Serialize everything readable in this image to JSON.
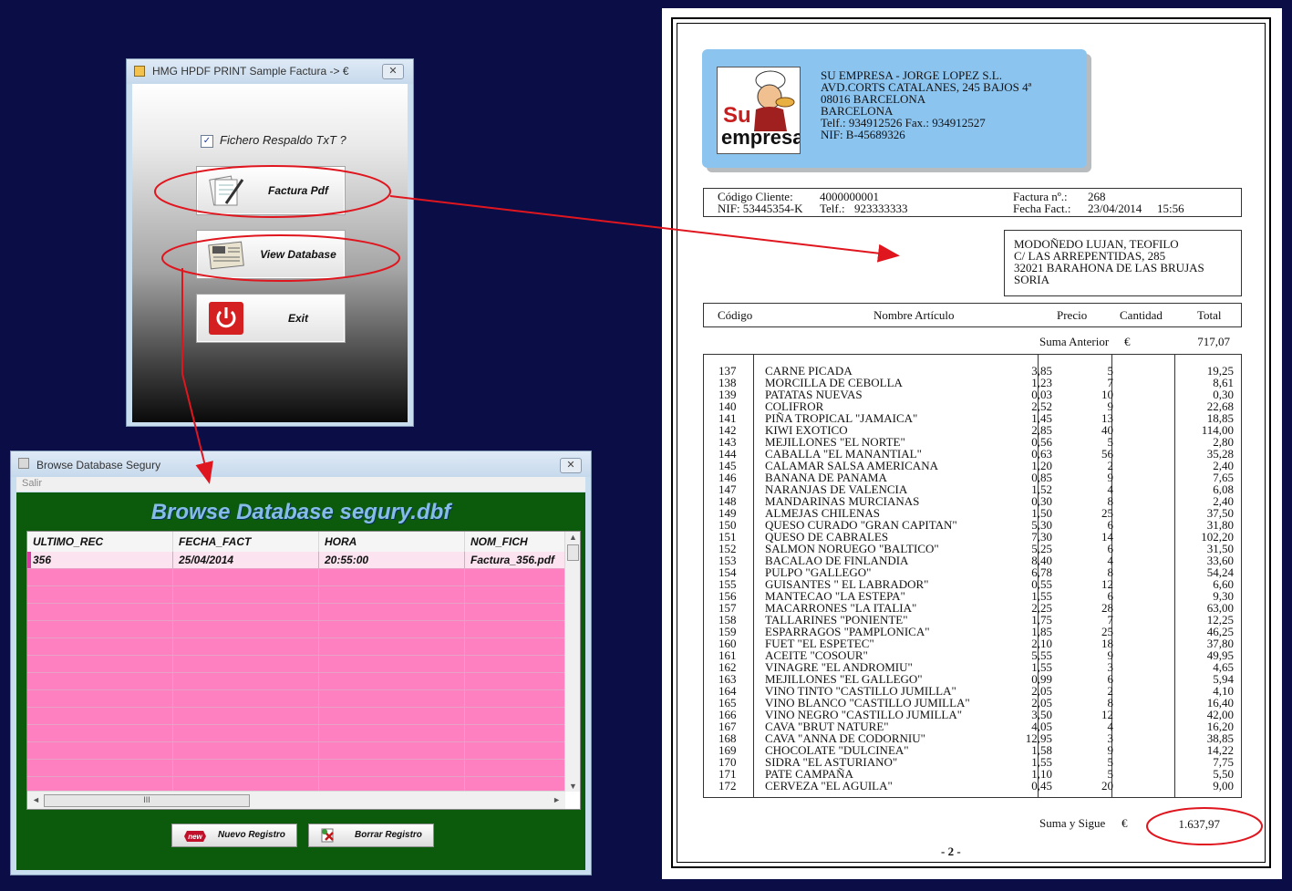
{
  "main_window": {
    "title": "HMG HPDF PRINT Sample Factura -> €",
    "checkbox_label": "Fichero Respaldo TxT ?",
    "checkbox_checked": true,
    "buttons": [
      "Factura Pdf",
      "View Database",
      "Exit"
    ]
  },
  "browse_window": {
    "title": "Browse Database Segury",
    "menu": [
      "Salir"
    ],
    "heading": "Browse Database segury.dbf",
    "columns": [
      "ULTIMO_REC",
      "FECHA_FACT",
      "HORA",
      "NOM_FICH"
    ],
    "rows": [
      [
        "356",
        "25/04/2014",
        "20:55:00",
        "Factura_356.pdf"
      ]
    ],
    "scroll_thumb": "III",
    "buttons": [
      "Nuevo Registro",
      "Borrar Registro"
    ],
    "new_badge": "new"
  },
  "invoice": {
    "logo": {
      "line1": "Su",
      "line2": "empresa"
    },
    "company_lines": [
      "SU EMPRESA - JORGE LOPEZ S.L.",
      "AVD.CORTS CATALANES, 245 BAJOS 4ª",
      "08016 BARCELONA",
      "BARCELONA",
      "Telf.: 934912526  Fax.: 934912527",
      "NIF:   B-45689326"
    ],
    "client_code_label": "Código Cliente:",
    "client_code": "4000000001",
    "nif": "NIF: 53445354-K",
    "phone_label": "Telf.:",
    "phone": "923333333",
    "invoice_no_label": "Factura nº.:",
    "invoice_no": "268",
    "date_label": "Fecha Fact.:",
    "date": "23/04/2014",
    "time": "15:56",
    "address": [
      "MODOÑEDO LUJAN, TEOFILO",
      "C/ LAS ARREPENTIDAS, 285",
      "32021 BARAHONA DE LAS BRUJAS",
      "SORIA"
    ],
    "col_headers": [
      "Código",
      "Nombre Artículo",
      "Precio",
      "Cantidad",
      "Total"
    ],
    "prev_sum_label": "Suma Anterior",
    "currency": "€",
    "prev_sum": "717,07",
    "items": [
      [
        "137",
        "CARNE PICADA",
        "3,85",
        "5",
        "19,25"
      ],
      [
        "138",
        "MORCILLA DE CEBOLLA",
        "1,23",
        "7",
        "8,61"
      ],
      [
        "139",
        "PATATAS NUEVAS",
        "0,03",
        "10",
        "0,30"
      ],
      [
        "140",
        "COLIFROR",
        "2,52",
        "9",
        "22,68"
      ],
      [
        "141",
        "PIÑA TROPICAL \"JAMAICA\"",
        "1,45",
        "13",
        "18,85"
      ],
      [
        "142",
        "KIWI EXOTICO",
        "2,85",
        "40",
        "114,00"
      ],
      [
        "143",
        "MEJILLONES \"EL NORTE\"",
        "0,56",
        "5",
        "2,80"
      ],
      [
        "144",
        "CABALLA \"EL MANANTIAL\"",
        "0,63",
        "56",
        "35,28"
      ],
      [
        "145",
        "CALAMAR SALSA AMERICANA",
        "1,20",
        "2",
        "2,40"
      ],
      [
        "146",
        "BANANA DE PANAMA",
        "0,85",
        "9",
        "7,65"
      ],
      [
        "147",
        "NARANJAS DE VALENCIA",
        "1,52",
        "4",
        "6,08"
      ],
      [
        "148",
        "MANDARINAS MURCIANAS",
        "0,30",
        "8",
        "2,40"
      ],
      [
        "149",
        "ALMEJAS CHILENAS",
        "1,50",
        "25",
        "37,50"
      ],
      [
        "150",
        "QUESO CURADO \"GRAN CAPITAN\"",
        "5,30",
        "6",
        "31,80"
      ],
      [
        "151",
        "QUESO DE CABRALES",
        "7,30",
        "14",
        "102,20"
      ],
      [
        "152",
        "SALMON NORUEGO \"BALTICO\"",
        "5,25",
        "6",
        "31,50"
      ],
      [
        "153",
        "BACALAO DE FINLANDIA",
        "8,40",
        "4",
        "33,60"
      ],
      [
        "154",
        "PULPO \"GALLEGO\"",
        "6,78",
        "8",
        "54,24"
      ],
      [
        "155",
        "GUISANTES \" EL LABRADOR\"",
        "0,55",
        "12",
        "6,60"
      ],
      [
        "156",
        "MANTECAO \"LA ESTEPA\"",
        "1,55",
        "6",
        "9,30"
      ],
      [
        "157",
        "MACARRONES \"LA ITALIA\"",
        "2,25",
        "28",
        "63,00"
      ],
      [
        "158",
        "TALLARINES \"PONIENTE\"",
        "1,75",
        "7",
        "12,25"
      ],
      [
        "159",
        "ESPARRAGOS \"PAMPLONICA\"",
        "1,85",
        "25",
        "46,25"
      ],
      [
        "160",
        "FUET \"EL ESPETEC\"",
        "2,10",
        "18",
        "37,80"
      ],
      [
        "161",
        "ACEITE \"COSOUR\"",
        "5,55",
        "9",
        "49,95"
      ],
      [
        "162",
        "VINAGRE \"EL ANDROMIU\"",
        "1,55",
        "3",
        "4,65"
      ],
      [
        "163",
        "MEJILLONES \"EL GALLEGO\"",
        "0,99",
        "6",
        "5,94"
      ],
      [
        "164",
        "VINO TINTO \"CASTILLO JUMILLA\"",
        "2,05",
        "2",
        "4,10"
      ],
      [
        "165",
        "VINO BLANCO \"CASTILLO JUMILLA\"",
        "2,05",
        "8",
        "16,40"
      ],
      [
        "166",
        "VINO NEGRO \"CASTILLO JUMILLA\"",
        "3,50",
        "12",
        "42,00"
      ],
      [
        "167",
        "CAVA \"BRUT NATURE\"",
        "4,05",
        "4",
        "16,20"
      ],
      [
        "168",
        "CAVA \"ANNA DE CODORNIU\"",
        "12,95",
        "3",
        "38,85"
      ],
      [
        "169",
        "CHOCOLATE \"DULCINEA\"",
        "1,58",
        "9",
        "14,22"
      ],
      [
        "170",
        "SIDRA \"EL ASTURIANO\"",
        "1,55",
        "5",
        "7,75"
      ],
      [
        "171",
        "PATE CAMPAÑA",
        "1,10",
        "5",
        "5,50"
      ],
      [
        "172",
        "CERVEZA \"EL AGUILA\"",
        "0,45",
        "20",
        "9,00"
      ]
    ],
    "carry_label": "Suma y Sigue",
    "carry_total": "1.637,97",
    "page_number": "- 2 -"
  },
  "annotation_color": "#e0161f"
}
